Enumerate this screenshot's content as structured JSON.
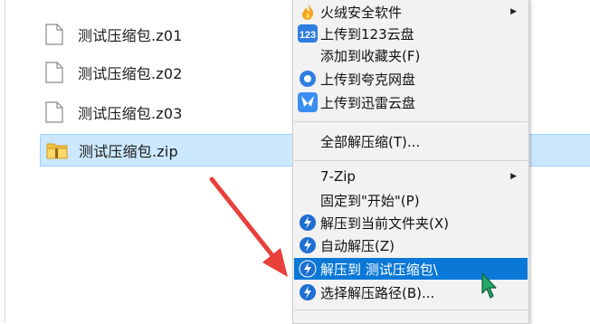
{
  "files": [
    {
      "name": "测试压缩包.z01",
      "icon": "blank-file-icon",
      "selected": false
    },
    {
      "name": "测试压缩包.z02",
      "icon": "blank-file-icon",
      "selected": false
    },
    {
      "name": "测试压缩包.z03",
      "icon": "blank-file-icon",
      "selected": false
    },
    {
      "name": "测试压缩包.zip",
      "icon": "zip-folder-icon",
      "selected": true
    }
  ],
  "context_menu": {
    "items": [
      {
        "label": "火绒安全软件",
        "icon": "huorong-flame-icon",
        "submenu": true
      },
      {
        "label": "上传到123云盘",
        "icon": "123pan-icon",
        "submenu": false
      },
      {
        "label": "添加到收藏夹(F)",
        "icon": "",
        "submenu": false
      },
      {
        "label": "上传到夸克网盘",
        "icon": "quark-icon",
        "submenu": false
      },
      {
        "label": "上传到迅雷云盘",
        "icon": "xunlei-icon",
        "submenu": false
      },
      {
        "label": "全部解压缩(T)...",
        "icon": "",
        "submenu": false
      },
      {
        "label": "7-Zip",
        "icon": "",
        "submenu": true
      },
      {
        "label": "固定到\"开始\"(P)",
        "icon": "",
        "submenu": false
      },
      {
        "label": "解压到当前文件夹(X)",
        "icon": "bandizip-icon",
        "submenu": false
      },
      {
        "label": "自动解压(Z)",
        "icon": "bandizip-icon",
        "submenu": false
      },
      {
        "label": "解压到 测试压缩包\\",
        "icon": "bandizip-icon",
        "submenu": false,
        "highlighted": true
      },
      {
        "label": "选择解压路径(B)...",
        "icon": "bandizip-icon",
        "submenu": false
      }
    ]
  },
  "colors": {
    "selection_bg": "#cce8ff",
    "selection_border": "#99d1ff",
    "menu_bg": "#f2f2f2",
    "menu_highlight": "#0a78d7",
    "annotation_arrow": "#e8403a",
    "cursor": "#27a86a"
  }
}
